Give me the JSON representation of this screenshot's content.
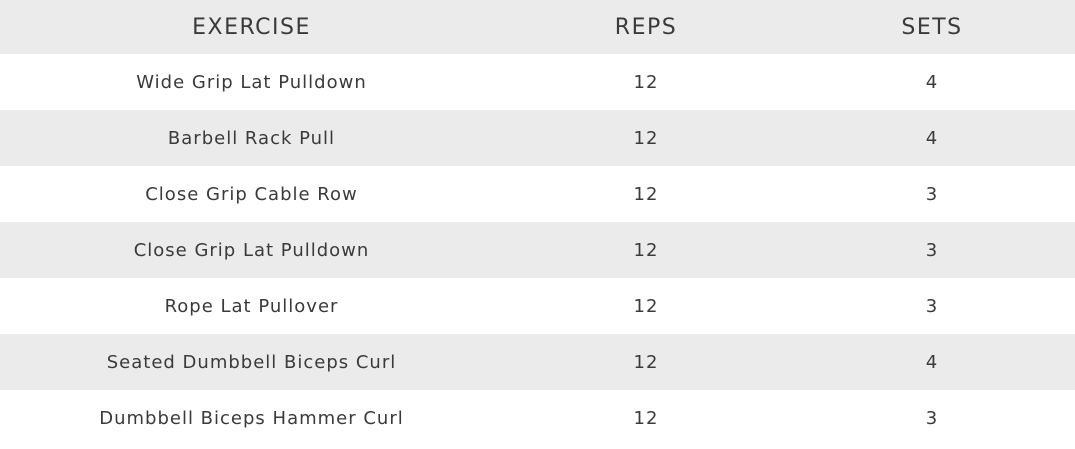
{
  "table": {
    "headers": {
      "exercise": "EXERCISE",
      "reps": "REPS",
      "sets": "SETS"
    },
    "rows": [
      {
        "exercise": "Wide Grip Lat Pulldown",
        "reps": "12",
        "sets": "4"
      },
      {
        "exercise": "Barbell Rack Pull",
        "reps": "12",
        "sets": "4"
      },
      {
        "exercise": "Close Grip Cable Row",
        "reps": "12",
        "sets": "3"
      },
      {
        "exercise": "Close Grip Lat Pulldown",
        "reps": "12",
        "sets": "3"
      },
      {
        "exercise": "Rope Lat Pullover",
        "reps": "12",
        "sets": "3"
      },
      {
        "exercise": "Seated Dumbbell Biceps Curl",
        "reps": "12",
        "sets": "4"
      },
      {
        "exercise": "Dumbbell Biceps Hammer Curl",
        "reps": "12",
        "sets": "3"
      }
    ]
  },
  "colors": {
    "stripe": "#ebebeb",
    "text": "#3a3a3a",
    "background": "#ffffff"
  }
}
